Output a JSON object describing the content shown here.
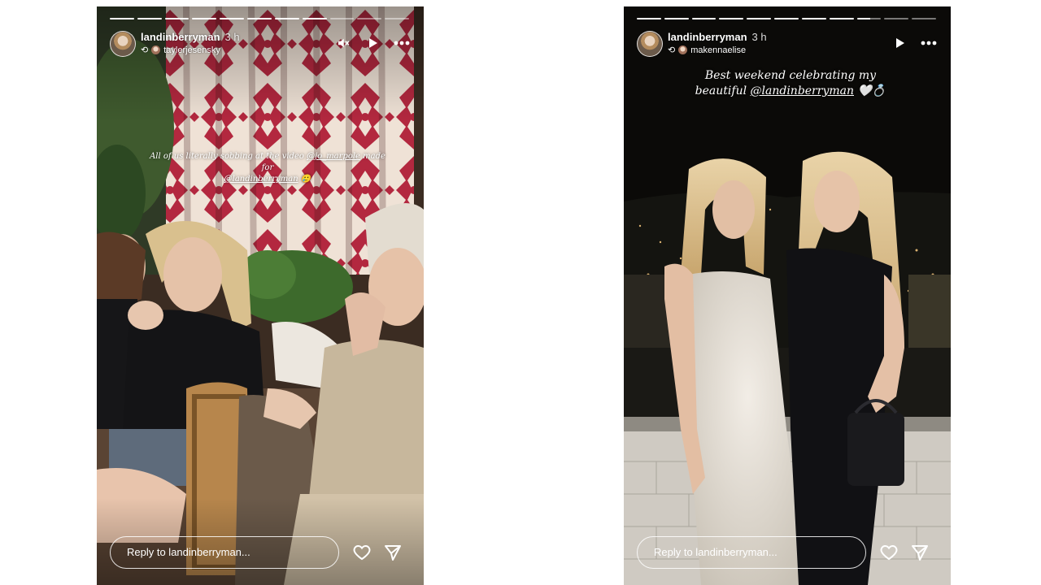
{
  "stories": [
    {
      "username": "landinberryman",
      "time": "3 h",
      "reposted_from": "taylerjesensky",
      "caption_text": "All of us literally sobbing at the video",
      "caption_mention": "@jo_marpole",
      "caption_after": "made for",
      "caption_mention_2": "@landinberryman",
      "caption_emoji": "🥲",
      "reply_placeholder": "Reply to landinberryman...",
      "icons": [
        "mute-icon",
        "play-icon",
        "more-icon",
        "heart-icon",
        "send-icon"
      ],
      "progress": {
        "segments": 11,
        "completed": 8
      }
    },
    {
      "username": "landinberryman",
      "time": "3 h",
      "reposted_from": "makennaelise",
      "caption_line1": "Best weekend celebrating my",
      "caption_line2_prefix": "beautiful",
      "caption_mention": "@landinberryman",
      "caption_emoji": "🤍💍",
      "reply_placeholder": "Reply to landinberryman...",
      "icons": [
        "play-icon",
        "more-icon",
        "heart-icon",
        "send-icon"
      ],
      "progress": {
        "segments": 11,
        "completed": 8.6
      }
    }
  ],
  "colors": {
    "curtain": "#b3283f",
    "curtain_bg": "#efe2d6",
    "night": "#0b0a08"
  }
}
